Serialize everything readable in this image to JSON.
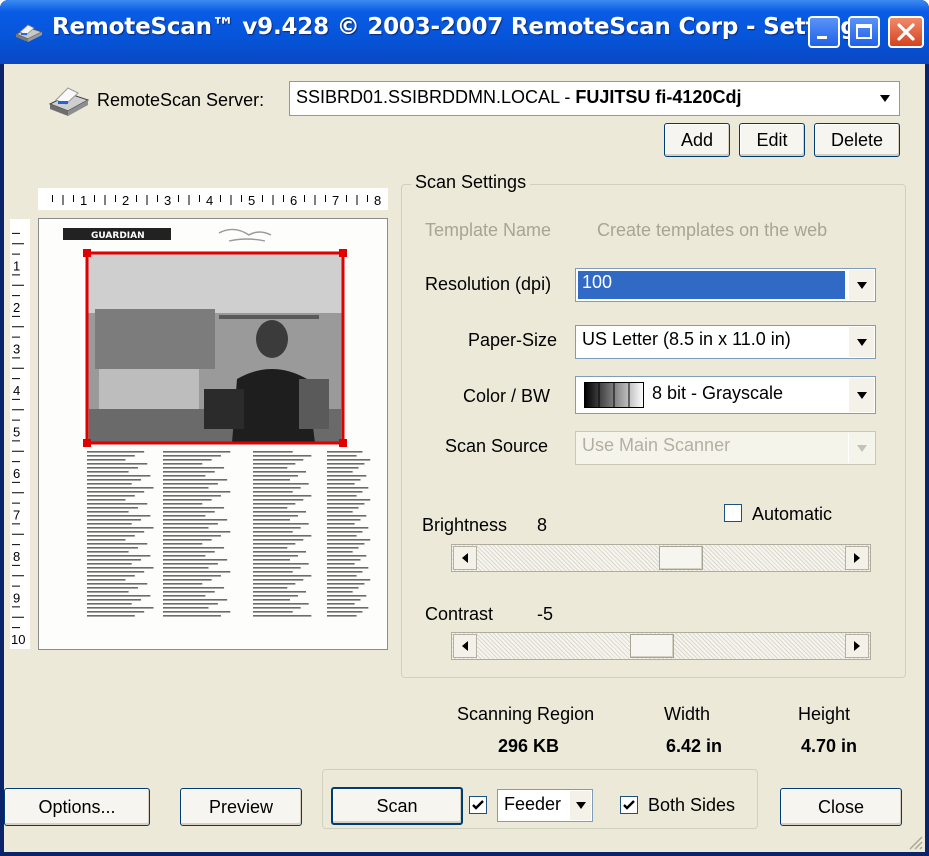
{
  "window": {
    "title": "RemoteScan™ v9.428 © 2003-2007 RemoteScan Corp - Settings",
    "icon": "scanner-icon"
  },
  "server": {
    "label": "RemoteScan Server:",
    "host": "SSIBRD01.SSIBRDDMN.LOCAL - ",
    "device": "FUJITSU fi-4120Cdj",
    "add_label": "Add",
    "edit_label": "Edit",
    "delete_label": "Delete"
  },
  "ruler": {
    "h_numbers": [
      "1",
      "2",
      "3",
      "4",
      "5",
      "6",
      "7",
      "8"
    ],
    "v_numbers": [
      "1",
      "2",
      "3",
      "4",
      "5",
      "6",
      "7",
      "8",
      "9",
      "10"
    ]
  },
  "preview": {
    "masthead": "GUARDIAN"
  },
  "scan_settings": {
    "group_title": "Scan Settings",
    "template_label": "Template Name",
    "template_hint": "Create templates on the web",
    "resolution_label": "Resolution (dpi)",
    "resolution_value": "100",
    "paper_label": "Paper-Size",
    "paper_value": "US Letter (8.5 in x 11.0 in)",
    "color_label": "Color / BW",
    "color_value": "8 bit - Grayscale",
    "source_label": "Scan Source",
    "source_value": "Use Main Scanner",
    "brightness_label": "Brightness",
    "brightness_value": "8",
    "automatic_label": "Automatic",
    "automatic_checked": false,
    "contrast_label": "Contrast",
    "contrast_value": "-5",
    "brightness_slider_fraction": 0.56,
    "contrast_slider_fraction": 0.47
  },
  "region": {
    "label": "Scanning Region",
    "size": "296 KB",
    "width_label": "Width",
    "width_value": "6.42 in",
    "height_label": "Height",
    "height_value": "4.70 in"
  },
  "actions": {
    "options_label": "Options...",
    "preview_label": "Preview",
    "scan_label": "Scan",
    "feeder_checked": true,
    "feeder_value": "Feeder",
    "both_sides_checked": true,
    "both_sides_label": "Both Sides",
    "close_label": "Close"
  },
  "colors": {
    "titlebar": "#0654d8",
    "window_bg": "#ece9d8",
    "selection": "#316ac5",
    "crop_frame": "#e00000"
  }
}
